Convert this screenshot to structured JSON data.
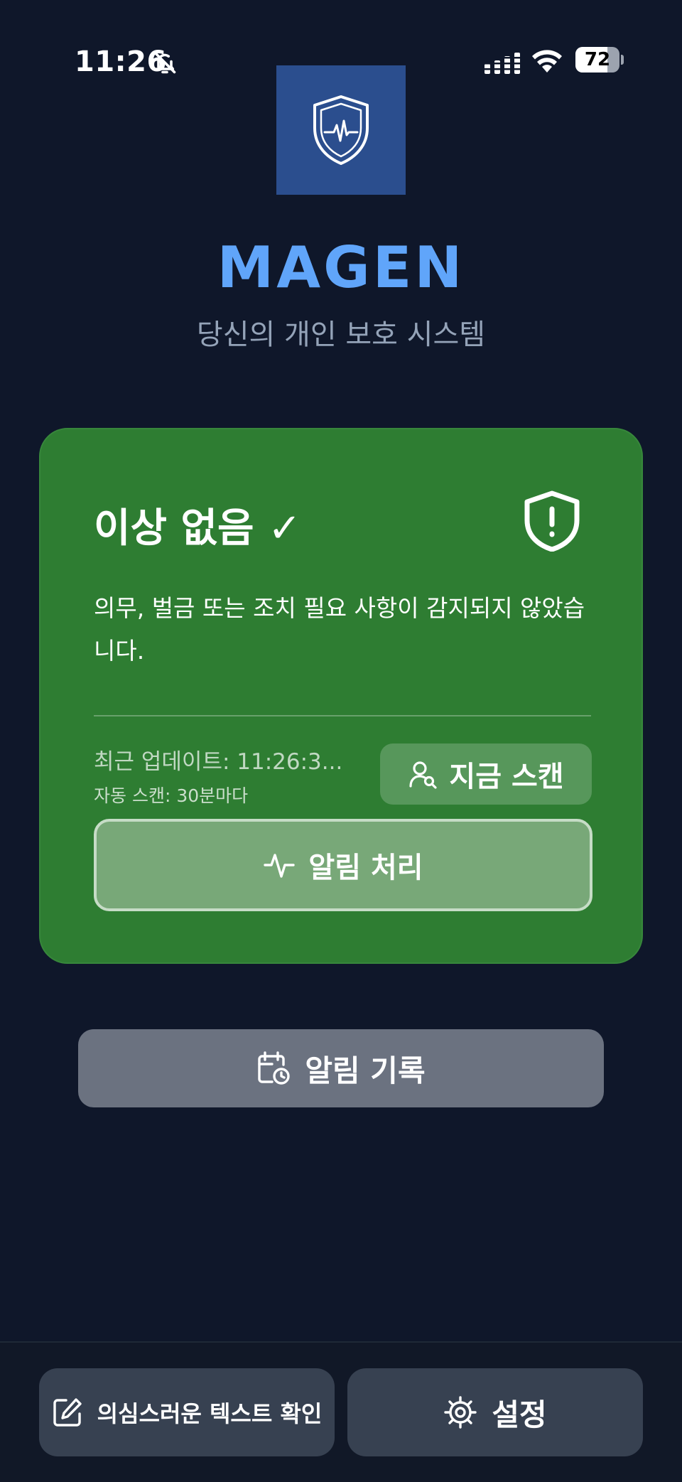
{
  "status_bar": {
    "time": "11:26",
    "battery_level": "72",
    "battery_fraction": 0.72,
    "icons": [
      "bell-slash-icon",
      "signal-icon",
      "wifi-icon",
      "battery-icon"
    ]
  },
  "header": {
    "logo_icon": "shield-pulse-icon",
    "title": "MAGEN",
    "subtitle": "당신의 개인 보호 시스템"
  },
  "status_card": {
    "title": "이상 없음 ✓",
    "message": "의무, 벌금 또는 조치 필요 사항이 감지되지 않았습니다.",
    "last_update": "최근 업데이트: 11:26:3...",
    "auto_scan": "자동 스캔: 30분마다",
    "scan_button_label": "지금 스캔",
    "handle_alerts_label": "알림 처리",
    "status_icon": "shield-alert-icon"
  },
  "alert_history": {
    "label": "알림 기록"
  },
  "bottom_bar": {
    "check_text_label": "의심스러운 텍스트 확인",
    "settings_label": "설정"
  },
  "colors": {
    "background": "#0f172a",
    "accent": "#60a5fa",
    "card_green": "#2e7d32",
    "history_button": "#6b7280",
    "bottom_button": "#374151"
  }
}
